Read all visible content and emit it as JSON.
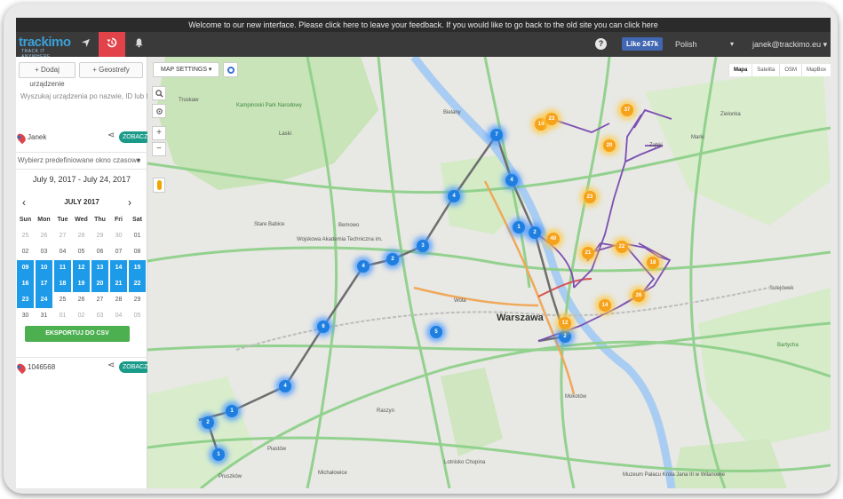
{
  "banner": {
    "text": "Welcome to our new interface. Please click here to leave your feedback. If you would like to go back to the old site you can click here"
  },
  "header": {
    "logo_text": "trackimo",
    "logo_sub": "TRACK IT ANYWHERE",
    "nav_icons": [
      "location-arrow-icon",
      "history-icon",
      "bell-icon"
    ],
    "help_label": "?",
    "facebook_like_label": "Like 247k",
    "language": "Polish",
    "user": "janek@trackimo.eu ▾",
    "accent_color": "#e2434b",
    "bar_color": "#3a3a3a"
  },
  "sidebar": {
    "add_device_label": "+ Dodaj urządzenie",
    "geofence_label": "+ Geostrefy",
    "search_hint": "Wyszukaj urządzenia po nazwie, ID lub tagu",
    "devices": [
      {
        "name": "Janek",
        "zoom_label": "ZOBACZ"
      },
      {
        "name": "1046568",
        "zoom_label": "ZOBACZ"
      }
    ],
    "preset_placeholder": "Wybierz predefiniowane okno czasowe",
    "date_range": "July 9, 2017 - July 24, 2017",
    "calendar": {
      "month": "JULY 2017",
      "prev": "‹",
      "next": "›",
      "weekdays": [
        "Sun",
        "Mon",
        "Tue",
        "Wed",
        "Thu",
        "Fri",
        "Sat"
      ],
      "weeks": [
        [
          "25",
          "26",
          "27",
          "28",
          "29",
          "30",
          "01"
        ],
        [
          "02",
          "03",
          "04",
          "05",
          "06",
          "07",
          "08"
        ],
        [
          "09",
          "10",
          "11",
          "12",
          "13",
          "14",
          "15"
        ],
        [
          "16",
          "17",
          "18",
          "19",
          "20",
          "21",
          "22"
        ],
        [
          "23",
          "24",
          "25",
          "26",
          "27",
          "28",
          "29"
        ],
        [
          "30",
          "31",
          "01",
          "02",
          "03",
          "04",
          "05"
        ]
      ],
      "selected_from": "09",
      "selected_to": "24",
      "selection_color": "#1e9be8"
    },
    "export_label": "EKSPORTUJ DO CSV",
    "export_color": "#4caf50"
  },
  "map": {
    "settings_label": "MAP SETTINGS ▾",
    "types": [
      "Mapa",
      "Satelita",
      "OSM",
      "MapBox"
    ],
    "active_type": "Mapa",
    "zoom_in": "+",
    "zoom_out": "−",
    "city_label": "Warszawa",
    "labels": [
      "Truskaw",
      "Kampinoski Park Narodowy",
      "Laski",
      "Bemowo",
      "Wojskowa Akademia Techniczna im.",
      "Stare Babice",
      "Zielonka",
      "Marki",
      "Ząbki",
      "Sulejówek",
      "Bartycha",
      "Piastów",
      "Pruszków",
      "Muzeum Pałacu Króla Jana III w Wilanowie",
      "Lotnisko Chopina",
      "Michałowice",
      "Raszyn",
      "Mokotów",
      "Wola",
      "Bielany"
    ],
    "route_colors": {
      "route": "#7b4fb3",
      "blue_marker": "#1f7fe0",
      "orange_marker": "#f6a21b"
    },
    "blue_markers": [
      "2",
      "1",
      "4",
      "6",
      "4",
      "2",
      "3",
      "4",
      "7",
      "4",
      "2",
      "1",
      "2",
      "1",
      "5"
    ],
    "orange_markers": [
      "14",
      "37",
      "20",
      "23",
      "40",
      "21",
      "22",
      "18",
      "26",
      "14",
      "12",
      "23"
    ]
  }
}
